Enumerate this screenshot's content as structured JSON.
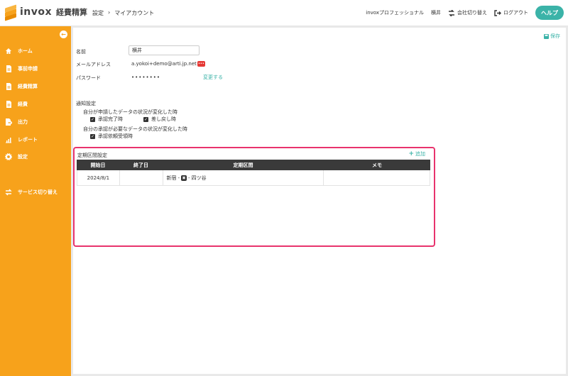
{
  "header": {
    "logo_text": "invox",
    "logo_sub": "経費精算",
    "breadcrumb": [
      "設定",
      "›",
      "マイアカウント"
    ],
    "plan": "invoxプロフェッショナル",
    "user": "横井",
    "switch_company": "会社切り替え",
    "logout": "ログアウト",
    "help": "ヘルプ"
  },
  "sidebar": {
    "items": [
      {
        "label": "ホーム",
        "icon": "home-icon"
      },
      {
        "label": "事前申請",
        "icon": "document-icon"
      },
      {
        "label": "経費精算",
        "icon": "document-icon"
      },
      {
        "label": "経費",
        "icon": "document-icon"
      },
      {
        "label": "出力",
        "icon": "export-icon"
      },
      {
        "label": "レポート",
        "icon": "chart-icon"
      },
      {
        "label": "設定",
        "icon": "gear-icon"
      },
      {
        "label": "サービス切り替え",
        "icon": "switch-icon"
      }
    ]
  },
  "account": {
    "save": "保存",
    "name_label": "名前",
    "name_value": "横井",
    "email_label": "メールアドレス",
    "email_value": "a.yokoi+demo@arti.jp.net",
    "password_label": "パスワード",
    "password_value": "••••••••",
    "change_password": "変更する"
  },
  "notifications": {
    "title": "通知設定",
    "group1": "自分が申請したデータの状況が変化した時",
    "opt_approved": "承認完了時",
    "opt_returned": "差し戻し時",
    "group2": "自分の承認が必要なデータの状況が変化した時",
    "opt_request": "承認依頼受領時"
  },
  "period": {
    "title": "定期区間設定",
    "add": "追加",
    "columns": [
      "開始日",
      "終了日",
      "定期区間",
      "メモ"
    ],
    "rows": [
      {
        "start": "2024/8/1",
        "end": "",
        "from": "新宿",
        "sep": "-",
        "to": "四ツ谷",
        "memo": ""
      }
    ]
  },
  "colors": {
    "accent": "#f7a21b",
    "link": "#3bb3a8",
    "highlight": "#e8336d"
  }
}
